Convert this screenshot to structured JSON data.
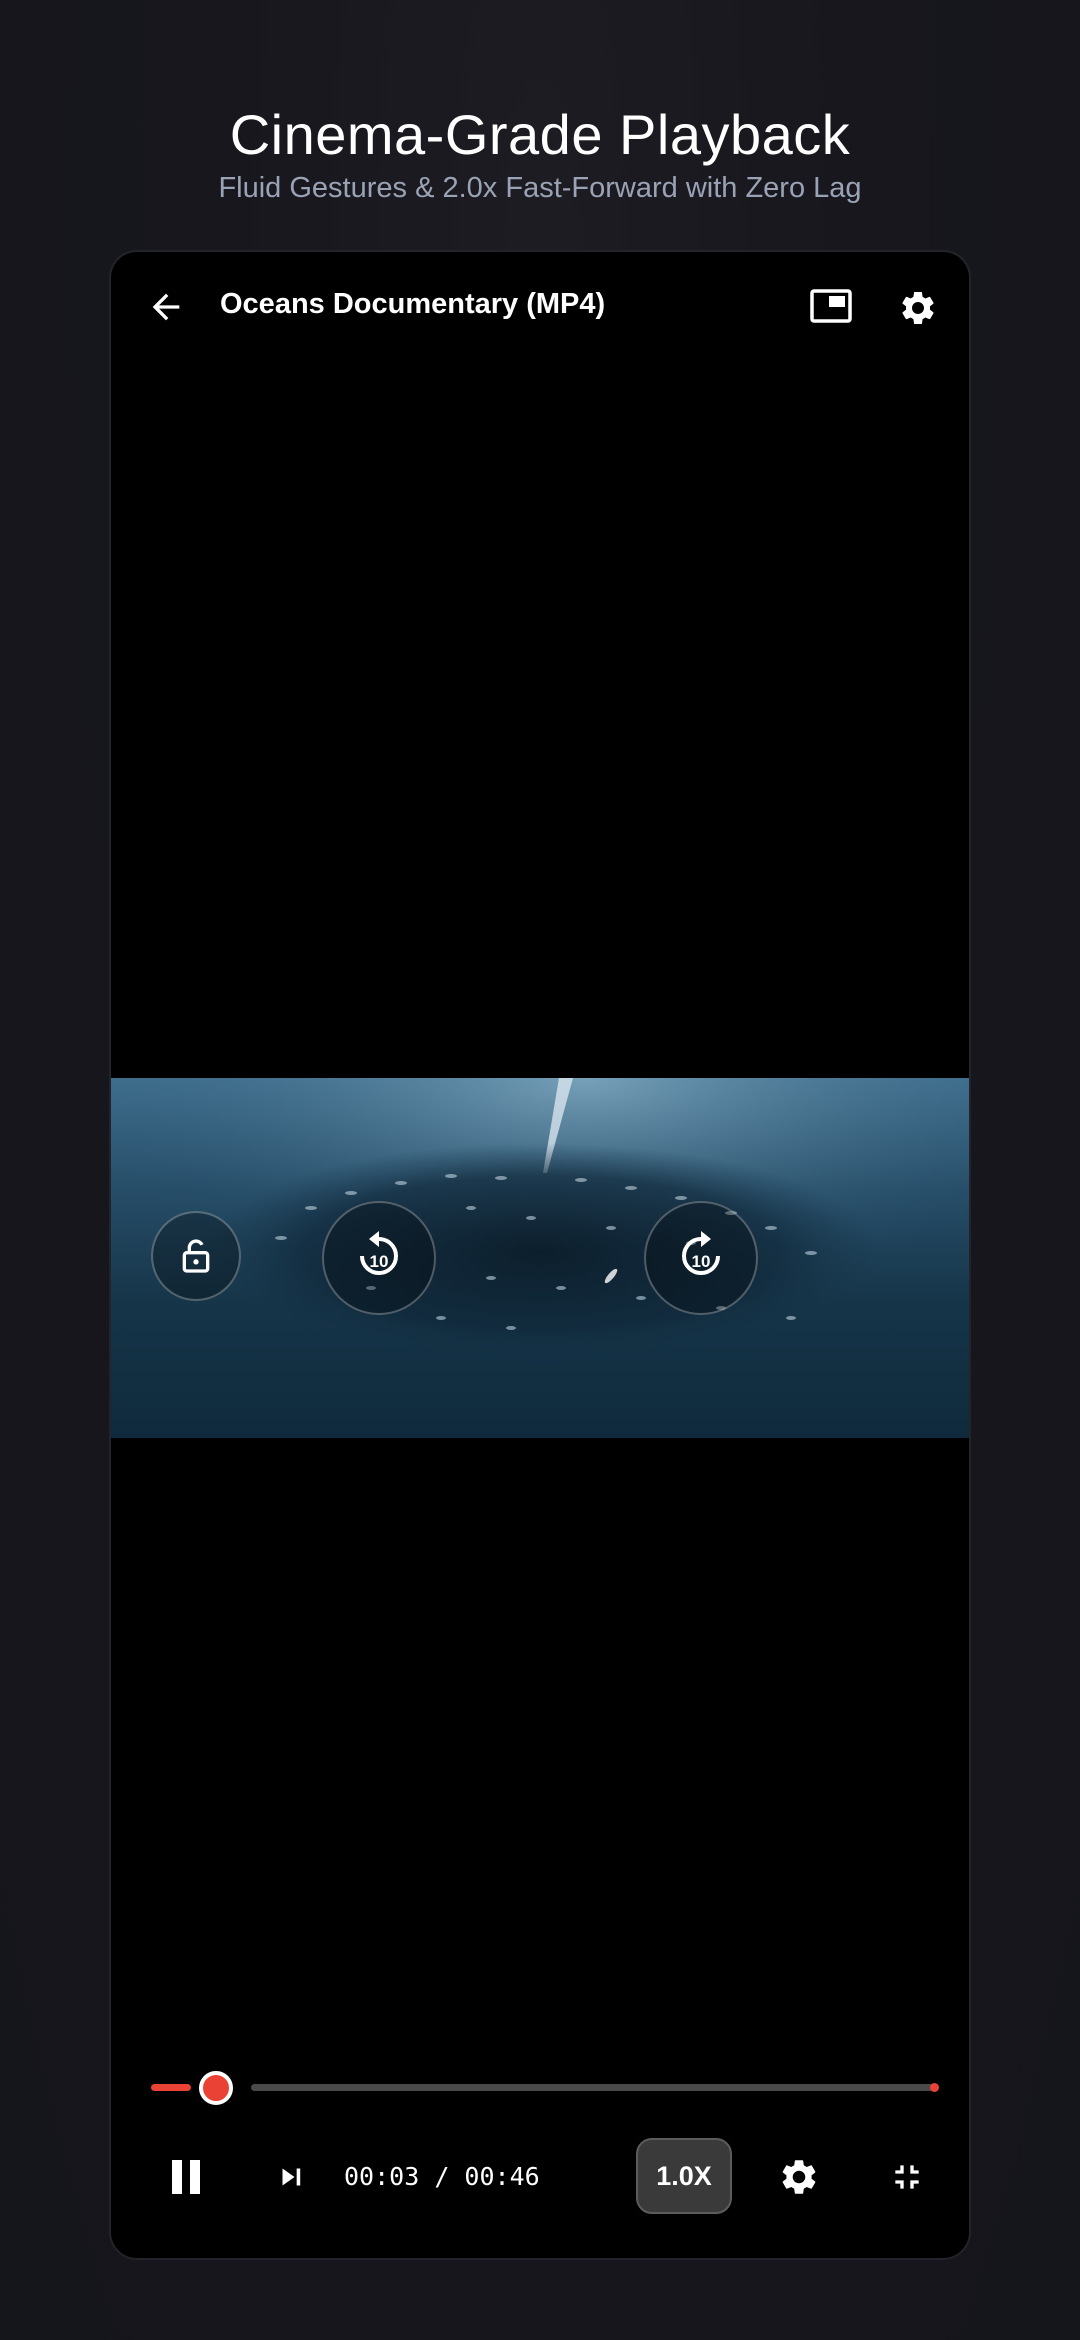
{
  "promo": {
    "headline": "Cinema-Grade Playback",
    "subheadline": "Fluid Gestures & 2.0x Fast-Forward with Zero Lag"
  },
  "player": {
    "title": "Oceans Documentary (MP4)",
    "current_time": "00:03",
    "separator": " / ",
    "duration": "00:46",
    "speed_label": "1.0X",
    "skip_back_seconds": "10",
    "skip_forward_seconds": "10",
    "progress_fraction": 0.065
  },
  "icons": {
    "back": "arrow-left-icon",
    "pip": "picture-in-picture-icon",
    "settings": "gear-icon",
    "lock": "lock-icon",
    "rewind": "replay-10-icon",
    "forward": "forward-10-icon",
    "pause": "pause-icon",
    "next": "skip-next-icon",
    "exit_fullscreen": "fullscreen-exit-icon"
  },
  "colors": {
    "accent": "#ea4335",
    "background": "#16171c",
    "player_background": "#000000",
    "subtitle_text": "#9aa3b5"
  }
}
